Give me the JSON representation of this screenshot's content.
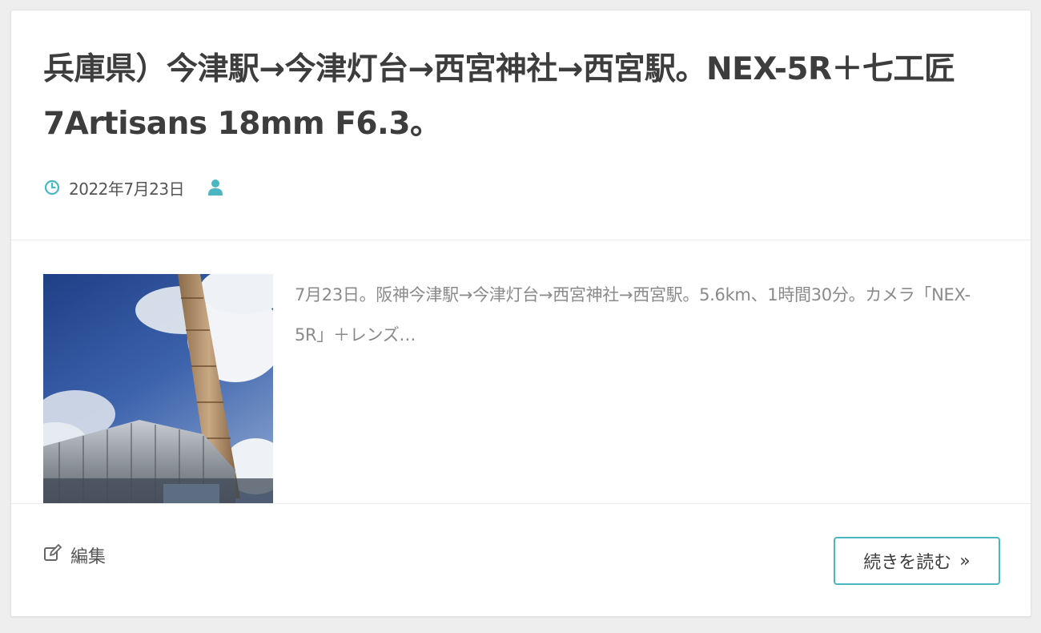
{
  "post": {
    "title": "兵庫県）今津駅→今津灯台→西宮神社→西宮駅。NEX-5R＋七工匠 7Artisans 18mm F6.3。",
    "date": "2022年7月23日",
    "excerpt": "7月23日。阪神今津駅→今津灯台→西宮神社→西宮駅。5.6km、1時間30分。カメラ「NEX-5R」＋レンズ…",
    "edit_label": "編集",
    "read_more_label": "続きを読む",
    "read_more_icon": "»"
  },
  "icons": {
    "date": "clock-icon",
    "author": "user-icon",
    "edit": "edit-icon"
  },
  "colors": {
    "accent": "#4ab7c3",
    "title": "#3d3d3d",
    "excerpt": "#8a8a8a"
  }
}
